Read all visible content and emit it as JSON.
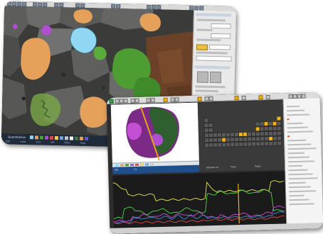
{
  "colors": {
    "accent_orange": "#e5a15a",
    "cyan_mineral": "#8fd7f2",
    "green_mineral": "#4e9d33",
    "purple_mineral": "#b04fd0",
    "titlebar_gray": "#dcdcdc",
    "highlight_yellow": "#f0b21a"
  },
  "back_window": {
    "status_label": "Quantitative",
    "tab_labels": [
      "Edit",
      "View",
      "Sort",
      "Mfl",
      "Filter",
      "Map"
    ],
    "phase_legend_colors": [
      "#8fd7f2",
      "#e5a15a",
      "#4e9d33",
      "#b04fd0",
      "#d84b4b",
      "#f0d24a",
      "#7aa0d8",
      "#c9c9c9",
      "#ffffff",
      "#3b7d3b",
      "#e5a15a",
      "#5a5ad8"
    ]
  },
  "front_window": {
    "status_tabs": [
      "FEI",
      "CL"
    ],
    "spectrum_series": [
      {
        "color": "#e8e84a",
        "name": ""
      },
      {
        "color": "#4ad84a",
        "name": ""
      },
      {
        "color": "#d84ad8",
        "name": ""
      },
      {
        "color": "#4a8ad8",
        "name": ""
      },
      {
        "color": "#d84a4a",
        "name": ""
      }
    ],
    "periodic_legend": [
      "Element Gr",
      "Ticks",
      "Peaks"
    ]
  }
}
